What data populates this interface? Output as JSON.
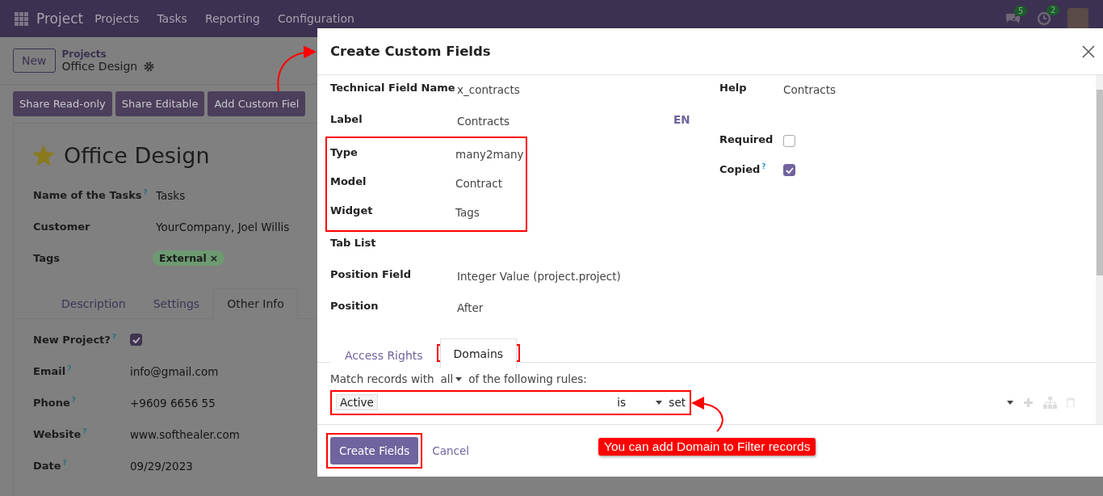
{
  "navbar": {
    "app_name": "Project",
    "menu": [
      "Projects",
      "Tasks",
      "Reporting",
      "Configuration"
    ],
    "messages_count": "5",
    "activities_count": "2"
  },
  "control_panel": {
    "new_button": "New",
    "breadcrumb_parent": "Projects",
    "breadcrumb_current": "Office Design"
  },
  "action_buttons": [
    "Share Read-only",
    "Share Editable",
    "Add Custom Fiel"
  ],
  "record": {
    "title": "Office Design",
    "starred": true,
    "fields": [
      {
        "label": "Name of the Tasks",
        "help": "?",
        "kind": "text",
        "value": "Tasks"
      },
      {
        "label": "Customer",
        "kind": "text",
        "value": "YourCompany, Joel Willis"
      },
      {
        "label": "Tags",
        "kind": "tags",
        "tags": [
          {
            "label": "External",
            "remove": "×"
          }
        ]
      }
    ],
    "tabs": [
      {
        "label": "Description",
        "selected": false
      },
      {
        "label": "Settings",
        "selected": false
      },
      {
        "label": "Other Info",
        "selected": true
      }
    ],
    "other_info": [
      {
        "label": "New Project?",
        "help": "?",
        "kind": "checkbox",
        "checked": true
      },
      {
        "label": "Email",
        "help": "?",
        "kind": "text",
        "value": "info@gmail.com"
      },
      {
        "label": "Phone",
        "help": "?",
        "kind": "text",
        "value": "+9609 6656 55"
      },
      {
        "label": "Website",
        "help": "?",
        "kind": "text",
        "value": "www.softhealer.com"
      },
      {
        "label": "Date",
        "help": "?",
        "kind": "text",
        "value": "09/29/2023"
      }
    ]
  },
  "dialog": {
    "title": "Create Custom Fields",
    "left_fields": [
      {
        "label": "Technical Field Name",
        "value": "x_contracts",
        "highlighted": false
      },
      {
        "label": "Label",
        "value": "Contracts",
        "lang": "EN",
        "highlighted": false
      },
      {
        "label": "Type",
        "value": "many2many",
        "highlighted": true
      },
      {
        "label": "Model",
        "value": "Contract",
        "highlighted": true
      },
      {
        "label": "Widget",
        "value": "Tags",
        "highlighted": true
      },
      {
        "label": "Tab List",
        "highlighted": false
      },
      {
        "label": "Position Field",
        "value": "Integer Value (project.project)",
        "highlighted": false
      },
      {
        "label": "Position",
        "value": "After",
        "highlighted": false
      }
    ],
    "right_fields": [
      {
        "label": "Help",
        "kind": "text",
        "value": "Contracts"
      },
      {
        "label": "Required",
        "kind": "checkbox",
        "checked": false
      },
      {
        "label": "Copied",
        "help": "?",
        "kind": "checkbox",
        "checked": true
      }
    ],
    "tabs": [
      {
        "label": "Access Rights",
        "selected": false,
        "highlighted": false
      },
      {
        "label": "Domains",
        "selected": true,
        "highlighted": true
      }
    ],
    "domain": {
      "prefix": "Match records with",
      "mode": "all",
      "suffix": "of the following rules:",
      "highlighted": true,
      "rules": [
        {
          "field": "Active",
          "operator": "is",
          "value": "set"
        }
      ]
    },
    "buttons": [
      {
        "label": "Create Fields",
        "kind": "primary",
        "highlighted": true
      },
      {
        "label": "Cancel",
        "kind": "link",
        "highlighted": false
      }
    ],
    "callout": "You can add Domain to Filter records"
  }
}
